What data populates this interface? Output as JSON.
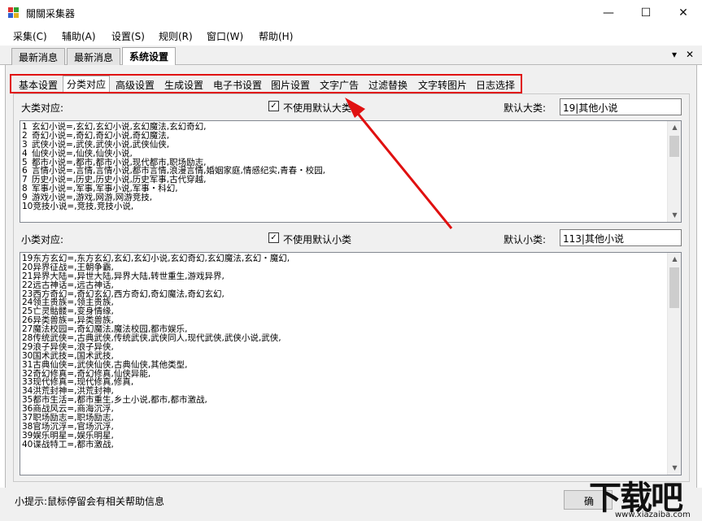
{
  "window": {
    "title": "關關采集器",
    "min_glyph": "—",
    "max_glyph": "☐",
    "close_glyph": "✕"
  },
  "menu": [
    "采集(C)",
    "辅助(A)",
    "设置(S)",
    "规则(R)",
    "窗口(W)",
    "帮助(H)"
  ],
  "doc_tabs": [
    "最新消息",
    "最新消息",
    "系统设置"
  ],
  "doc_tab_controls": {
    "dropdown": "▾",
    "close": "✕"
  },
  "inner_tabs": [
    "基本设置",
    "分类对应",
    "高级设置",
    "生成设置",
    "电子书设置",
    "图片设置",
    "文字广告",
    "过滤替换",
    "文字转图片",
    "日志选择"
  ],
  "major": {
    "label": "大类对应:",
    "checkbox_label": "不使用默认大类",
    "checkbox_checked": true,
    "default_label": "默认大类:",
    "default_value": "19|其他小说",
    "lines": [
      "1|玄幻小说=,玄幻,玄幻小说,玄幻魔法,玄幻奇幻,",
      "2|奇幻小说=,奇幻,奇幻小说,奇幻魔法,",
      "3|武侠小说=,武侠,武侠小说,武侠仙侠,",
      "4|仙侠小说=,仙侠,仙侠小说,",
      "5|都市小说=,都市,都市小说,现代都市,职场励志,",
      "6|言情小说=,言情,言情小说,都市言情,浪漫言情,婚姻家庭,情感纪实,青春・校园,",
      "7|历史小说=,历史,历史小说,历史军事,古代穿越,",
      "8|军事小说=,军事,军事小说,军事・科幻,",
      "9|游戏小说=,游戏,网游,网游竞技,",
      "10|竞技小说=,竞技,竞技小说,"
    ]
  },
  "minor": {
    "label": "小类对应:",
    "checkbox_label": "不使用默认小类",
    "checkbox_checked": true,
    "default_label": "默认小类:",
    "default_value": "113|其他小说",
    "lines": [
      "19|东方玄幻=,东方玄幻,玄幻,玄幻小说,玄幻奇幻,玄幻魔法,玄幻・魔幻,",
      "20|异界征战=,王朝争霸,",
      "21|异界大陆=,异世大陆,异界大陆,转世重生,游戏异界,",
      "22|远古神话=,远古神话,",
      "23|西方奇幻=,奇幻玄幻,西方奇幻,奇幻魔法,奇幻玄幻,",
      "24|领主贵族=,领主贵族,",
      "25|亡灵骷髅=,变身情缘,",
      "26|异类兽族=,异类兽族,",
      "27|魔法校园=,奇幻魔法,魔法校园,都市娱乐,",
      "28|传统武侠=,古典武侠,传统武侠,武侠同人,现代武侠,武侠小说,武侠,",
      "29|浪子异侠=,浪子异侠,",
      "30|国术武技=,国术武技,",
      "31|古典仙侠=,武侠仙侠,古典仙侠,其他类型,",
      "32|奇幻修真=,奇幻修真,仙侠异能,",
      "33|现代修真=,现代修真,修真,",
      "34|洪荒封神=,洪荒封神,",
      "35|都市生活=,都市重生,乡土小说,都市,都市激战,",
      "36|商战风云=,商海沉浮,",
      "37|职场励志=,职场励志,",
      "38|官场沉浮=,官场沉浮,",
      "39|娱乐明星=,娱乐明星,",
      "40|谍战特工=,都市激战,"
    ]
  },
  "status": {
    "hint": "小提示:鼠标停留会有相关帮助信息",
    "ok_label": "确"
  },
  "watermark": {
    "big": "下载吧",
    "small": "www.xiazaiba.com"
  },
  "colors": {
    "highlight": "#e01010",
    "panel_bg": "#f0f0f0"
  }
}
